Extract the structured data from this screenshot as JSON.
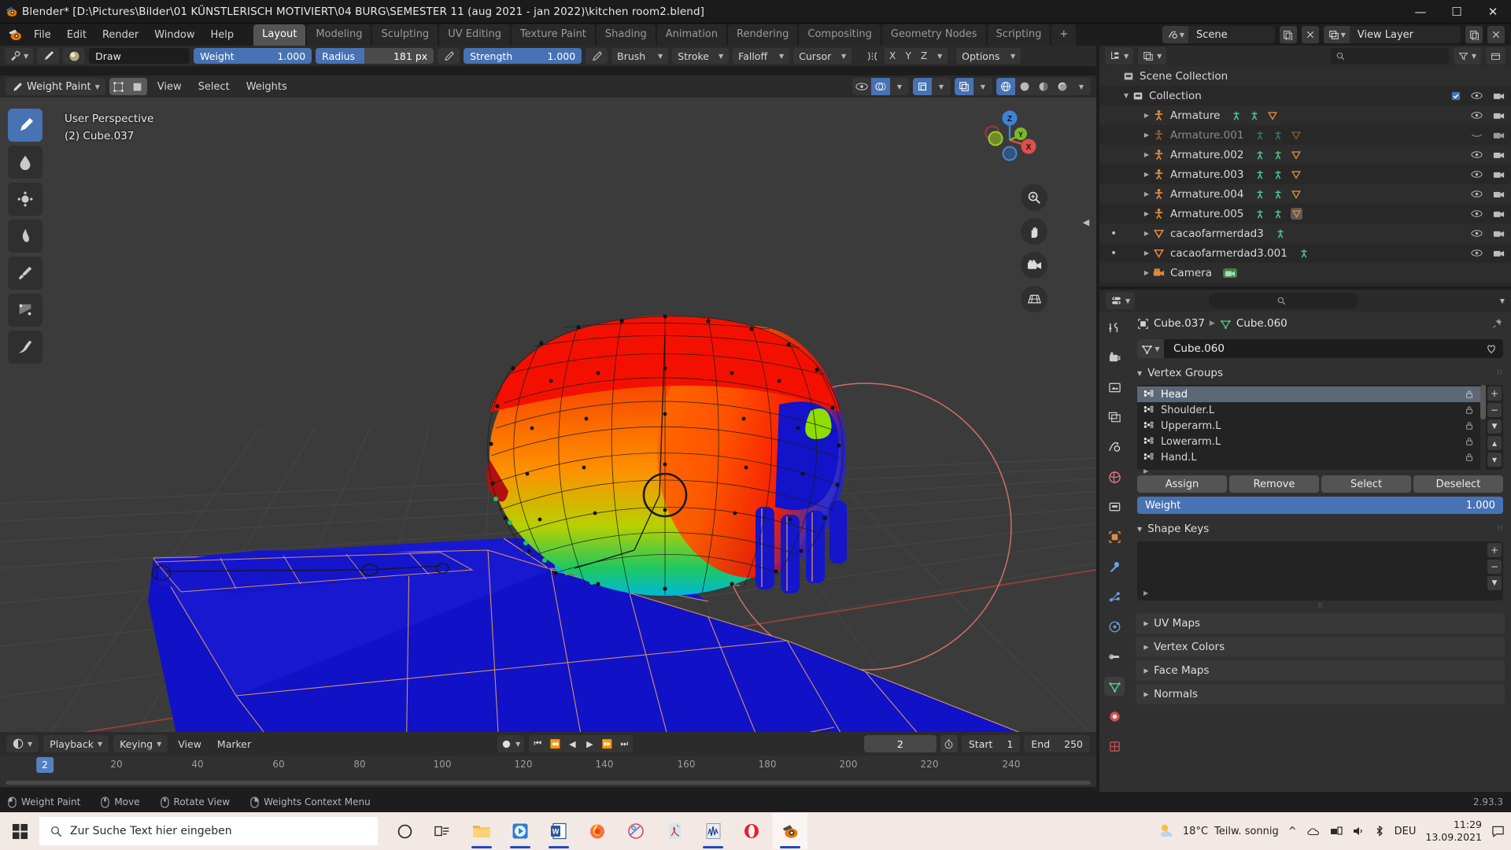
{
  "window": {
    "title": "Blender* [D:\\Pictures\\Bilder\\01 KÜNSTLERISCH MOTIVIERT\\04 BURG\\SEMESTER 11 (aug 2021 - jan 2022)\\kitchen room2.blend]",
    "minimize": "—",
    "maximize": "☐",
    "close": "✕"
  },
  "topbar": {
    "menus": [
      "File",
      "Edit",
      "Render",
      "Window",
      "Help"
    ],
    "workspaces": [
      {
        "label": "Layout",
        "active": true
      },
      {
        "label": "Modeling",
        "active": false
      },
      {
        "label": "Sculpting",
        "active": false
      },
      {
        "label": "UV Editing",
        "active": false
      },
      {
        "label": "Texture Paint",
        "active": false
      },
      {
        "label": "Shading",
        "active": false
      },
      {
        "label": "Animation",
        "active": false
      },
      {
        "label": "Rendering",
        "active": false
      },
      {
        "label": "Compositing",
        "active": false
      },
      {
        "label": "Geometry Nodes",
        "active": false
      },
      {
        "label": "Scripting",
        "active": false
      }
    ],
    "add_workspace": "+",
    "scene_name": "Scene",
    "view_layer_name": "View Layer"
  },
  "tool_header": {
    "brush_name": "Draw",
    "weight_label": "Weight",
    "weight_value": "1.000",
    "radius_label": "Radius",
    "radius_value": "181 px",
    "strength_label": "Strength",
    "strength_value": "1.000",
    "brush_menu": "Brush",
    "stroke_menu": "Stroke",
    "falloff_menu": "Falloff",
    "cursor_menu": "Cursor",
    "axis_x": "X",
    "axis_y": "Y",
    "axis_z": "Z",
    "options_menu": "Options"
  },
  "viewport_header": {
    "mode": "Weight Paint",
    "menus": [
      "View",
      "Select",
      "Weights"
    ]
  },
  "viewport": {
    "perspective_label": "User Perspective",
    "object_label": "(2) Cube.037",
    "gizmo_axes": {
      "x": "X",
      "y": "Y",
      "z": "Z"
    }
  },
  "outliner": {
    "search_placeholder": "",
    "rows": [
      {
        "name": "Scene Collection",
        "indent": 0,
        "icon": "collection-icon",
        "dim": false,
        "expand": "",
        "badges": [],
        "eye": false,
        "camera": false
      },
      {
        "name": "Collection",
        "indent": 1,
        "icon": "collection-icon",
        "dim": false,
        "expand": "▼",
        "badges": [],
        "eye": true,
        "camera": true
      },
      {
        "name": "Armature",
        "indent": 2,
        "icon": "armature-icon",
        "dim": false,
        "expand": "▶",
        "badges": [
          "pose",
          "armature-data",
          "mesh-data"
        ],
        "eye": true,
        "camera": true
      },
      {
        "name": "Armature.001",
        "indent": 2,
        "icon": "armature-icon",
        "dim": true,
        "expand": "▶",
        "badges": [
          "pose",
          "armature-data",
          "mesh-data"
        ],
        "eye": true,
        "camera": true
      },
      {
        "name": "Armature.002",
        "indent": 2,
        "icon": "armature-icon",
        "dim": false,
        "expand": "▶",
        "badges": [
          "pose",
          "armature-data",
          "mesh-data"
        ],
        "eye": true,
        "camera": true
      },
      {
        "name": "Armature.003",
        "indent": 2,
        "icon": "armature-icon",
        "dim": false,
        "expand": "▶",
        "badges": [
          "pose",
          "armature-data",
          "mesh-data"
        ],
        "eye": true,
        "camera": true
      },
      {
        "name": "Armature.004",
        "indent": 2,
        "icon": "armature-icon",
        "dim": false,
        "expand": "▶",
        "badges": [
          "pose",
          "armature-data",
          "mesh-data"
        ],
        "eye": true,
        "camera": true
      },
      {
        "name": "Armature.005",
        "indent": 2,
        "icon": "armature-icon",
        "dim": false,
        "expand": "▶",
        "badges": [
          "pose",
          "armature-data",
          "mesh-data-sel"
        ],
        "eye": true,
        "camera": true
      },
      {
        "name": "cacaofarmerdad3",
        "indent": 2,
        "icon": "mesh-icon",
        "dim": false,
        "expand": "▶",
        "badges": [
          "mesh-data"
        ],
        "eye": true,
        "camera": true
      },
      {
        "name": "cacaofarmerdad3.001",
        "indent": 2,
        "icon": "mesh-icon",
        "dim": false,
        "expand": "▶",
        "badges": [
          "mesh-data"
        ],
        "eye": true,
        "camera": true
      },
      {
        "name": "Camera",
        "indent": 2,
        "icon": "camera-icon",
        "dim": false,
        "expand": "▶",
        "badges": [
          "camera-data"
        ],
        "eye": true,
        "camera": true
      }
    ]
  },
  "properties": {
    "search_placeholder": "",
    "breadcrumb_object": "Cube.037",
    "breadcrumb_data": "Cube.060",
    "mesh_data_name": "Cube.060",
    "panels": {
      "vertex_groups": "Vertex Groups",
      "shape_keys": "Shape Keys",
      "uv_maps": "UV Maps",
      "vertex_colors": "Vertex Colors",
      "face_maps": "Face Maps",
      "normals": "Normals"
    },
    "vertex_groups": [
      {
        "name": "Head",
        "selected": true
      },
      {
        "name": "Shoulder.L",
        "selected": false
      },
      {
        "name": "Upperarm.L",
        "selected": false
      },
      {
        "name": "Lowerarm.L",
        "selected": false
      },
      {
        "name": "Hand.L",
        "selected": false
      }
    ],
    "buttons": [
      "Assign",
      "Remove",
      "Select",
      "Deselect"
    ],
    "weight_label": "Weight",
    "weight_value": "1.000",
    "side_buttons": [
      "+",
      "−",
      "▴",
      "▾"
    ]
  },
  "timeline": {
    "playback_menu": "Playback",
    "keying_menu": "Keying",
    "view_menu": "View",
    "marker_menu": "Marker",
    "current_frame": "2",
    "start_label": "Start",
    "start_value": "1",
    "end_label": "End",
    "end_value": "250",
    "ticks": [
      "20",
      "40",
      "60",
      "80",
      "100",
      "120",
      "140",
      "160",
      "180",
      "200",
      "220",
      "240"
    ],
    "playhead_frame": "2"
  },
  "statusbar": {
    "items": [
      {
        "label": "Weight Paint",
        "icon": "mouse-left-icon"
      },
      {
        "label": "Move",
        "icon": "mouse-middle-icon"
      },
      {
        "label": "Rotate View",
        "icon": "mouse-middle-icon"
      },
      {
        "label": "Weights Context Menu",
        "icon": "mouse-right-icon"
      }
    ],
    "version": "2.93.3"
  },
  "taskbar": {
    "search_placeholder": "Zur Suche Text hier eingeben",
    "weather_temp": "18°C",
    "weather_text": "Teilw. sonnig",
    "language": "DEU",
    "time": "11:29",
    "date": "13.09.2021",
    "apps": [
      {
        "name": "cortana-icon",
        "running": false,
        "active": false
      },
      {
        "name": "task-view-icon",
        "running": false,
        "active": false
      },
      {
        "name": "file-explorer-icon",
        "running": true,
        "active": false
      },
      {
        "name": "vlc-media-icon",
        "running": true,
        "active": false
      },
      {
        "name": "word-icon",
        "running": true,
        "active": false
      },
      {
        "name": "firefox-icon",
        "running": false,
        "active": false
      },
      {
        "name": "paint-net-icon",
        "running": false,
        "active": false
      },
      {
        "name": "adobe-reader-icon",
        "running": false,
        "active": false
      },
      {
        "name": "audacity-icon",
        "running": true,
        "active": false
      },
      {
        "name": "opera-icon",
        "running": false,
        "active": false
      },
      {
        "name": "blender-icon",
        "running": true,
        "active": true
      }
    ]
  },
  "colors": {
    "accent_blue": "#4772b3",
    "panel_bg": "#303030",
    "header_bg": "#2b2b2b",
    "viewport_bg": "#3b3b3b",
    "outliner_bg": "#282828",
    "armature_orange": "#e08a3c",
    "selection": "#5b6878"
  }
}
